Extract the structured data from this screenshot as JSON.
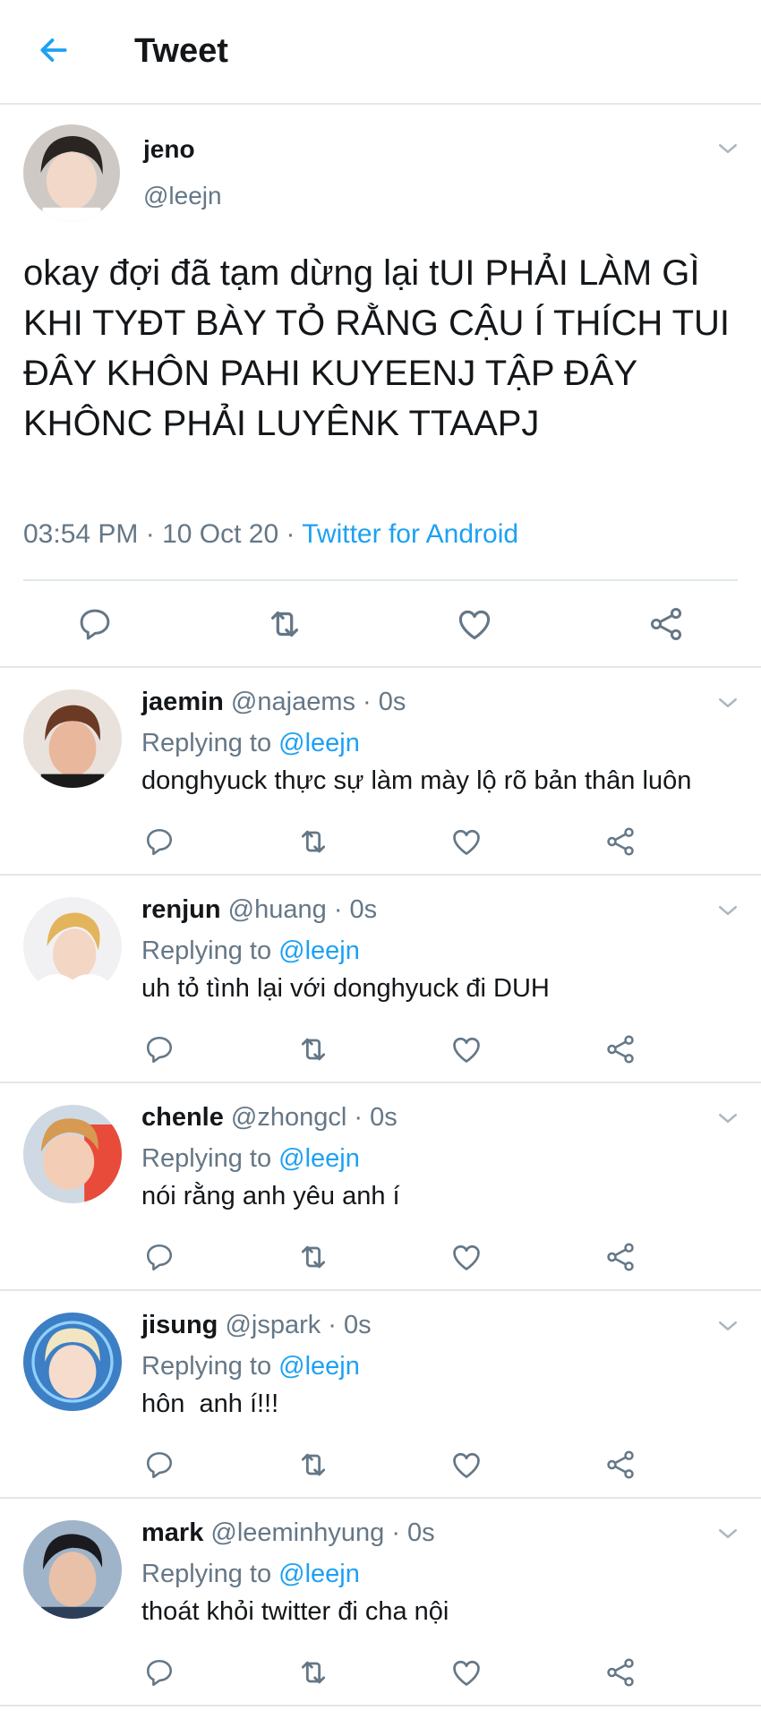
{
  "header": {
    "title": "Tweet"
  },
  "tweet": {
    "name": "jeno",
    "handle": "@leejn",
    "text": "okay đợi đã tạm dừng lại tUI PHẢI LÀM GÌ KHI TYĐT BÀY TỎ RẰNG CẬU Í THÍCH TUI ĐÂY KHÔN PAHI KUYEENJ TẬP ĐÂY KHÔNC PHẢI LUYÊNK TTAAPJ",
    "time": "03:54 PM · 10 Oct 20 · ",
    "source": "Twitter for Android"
  },
  "replies": [
    {
      "name": "jaemin",
      "meta": " @najaems · 0s",
      "replying_label": "Replying to ",
      "mention": "@leejn",
      "text": "donghyuck thực sự làm mày lộ rõ bản thân luôn"
    },
    {
      "name": "renjun",
      "meta": " @huang · 0s",
      "replying_label": "Replying to ",
      "mention": "@leejn",
      "text": "uh tỏ tình lại với donghyuck đi DUH"
    },
    {
      "name": "chenle",
      "meta": " @zhongcl · 0s",
      "replying_label": "Replying to ",
      "mention": "@leejn",
      "text": "nói rằng anh yêu anh í"
    },
    {
      "name": "jisung",
      "meta": " @jspark · 0s",
      "replying_label": "Replying to ",
      "mention": "@leejn",
      "text": "hôn  anh í!!!"
    },
    {
      "name": "mark",
      "meta": " @leeminhyung · 0s",
      "replying_label": "Replying to ",
      "mention": "@leejn",
      "text": "thoát khỏi twitter đi cha nội"
    }
  ],
  "colors": {
    "accent": "#1da1f2",
    "muted": "#657786",
    "text": "#14171a",
    "divider": "#e1e8ed"
  },
  "icons": [
    "back-arrow-icon",
    "chevron-down-icon",
    "reply-icon",
    "retweet-icon",
    "like-icon",
    "share-icon"
  ]
}
